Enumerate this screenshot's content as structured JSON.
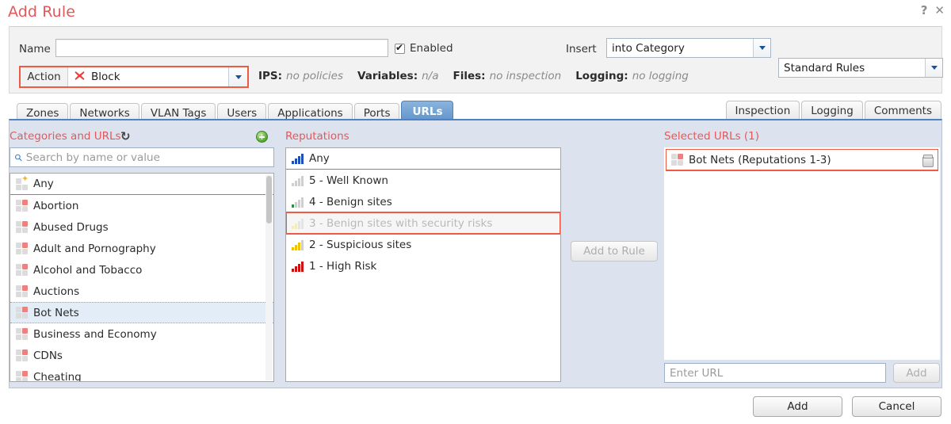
{
  "dialog": {
    "title": "Add Rule",
    "help_icon": "?",
    "close_icon": "✕"
  },
  "header": {
    "name_label": "Name",
    "name_value": "",
    "name_placeholder": "",
    "enabled_label": "Enabled",
    "enabled_checked": true,
    "insert_label": "Insert",
    "insert_value": "into Category",
    "category_value": "Standard Rules",
    "action_label": "Action",
    "action_value": "Block",
    "action_icon": "✖",
    "meta": [
      {
        "label": "IPS:",
        "value": "no policies"
      },
      {
        "label": "Variables:",
        "value": "n/a"
      },
      {
        "label": "Files:",
        "value": "no inspection"
      },
      {
        "label": "Logging:",
        "value": "no logging"
      }
    ]
  },
  "tabs_left": [
    {
      "label": "Zones",
      "active": false
    },
    {
      "label": "Networks",
      "active": false
    },
    {
      "label": "VLAN Tags",
      "active": false
    },
    {
      "label": "Users",
      "active": false
    },
    {
      "label": "Applications",
      "active": false
    },
    {
      "label": "Ports",
      "active": false
    },
    {
      "label": "URLs",
      "active": true
    }
  ],
  "tabs_right": [
    {
      "label": "Inspection",
      "active": false
    },
    {
      "label": "Logging",
      "active": false
    },
    {
      "label": "Comments",
      "active": false
    }
  ],
  "categories_panel": {
    "title": "Categories and URLs",
    "refresh_icon": "↻",
    "add_icon": "plus-circle-icon",
    "search_placeholder": "Search by name or value",
    "search_value": "",
    "items": [
      {
        "label": "Any",
        "kind": "any",
        "selected": false
      },
      {
        "label": "Abortion",
        "kind": "category",
        "selected": false
      },
      {
        "label": "Abused Drugs",
        "kind": "category",
        "selected": false
      },
      {
        "label": "Adult and Pornography",
        "kind": "category",
        "selected": false
      },
      {
        "label": "Alcohol and Tobacco",
        "kind": "category",
        "selected": false
      },
      {
        "label": "Auctions",
        "kind": "category",
        "selected": false
      },
      {
        "label": "Bot Nets",
        "kind": "category",
        "selected": true
      },
      {
        "label": "Business and Economy",
        "kind": "category",
        "selected": false
      },
      {
        "label": "CDNs",
        "kind": "category",
        "selected": false
      },
      {
        "label": "Cheating",
        "kind": "category",
        "selected": false
      }
    ]
  },
  "reputations_panel": {
    "title": "Reputations",
    "items": [
      {
        "label": "Any",
        "color": "#1f4fb5",
        "bars": 4,
        "divider": true,
        "highlight": false
      },
      {
        "label": "5 - Well Known",
        "color": "#cfcfcf",
        "bars": 0,
        "divider": false,
        "highlight": false
      },
      {
        "label": "4 - Benign sites",
        "color": "#2f8f3f",
        "bars": 1,
        "divider": false,
        "highlight": false
      },
      {
        "label": "3 - Benign sites with security risks",
        "color": "#f5e27a",
        "bars": 2,
        "divider": false,
        "highlight": true
      },
      {
        "label": "2 - Suspicious sites",
        "color": "#f2c300",
        "bars": 3,
        "divider": false,
        "highlight": false
      },
      {
        "label": "1 - High Risk",
        "color": "#cc1111",
        "bars": 4,
        "divider": false,
        "highlight": false
      }
    ],
    "add_to_rule_label": "Add to Rule"
  },
  "selected_panel": {
    "title": "Selected URLs (1)",
    "items": [
      {
        "label": "Bot Nets (Reputations 1-3)",
        "delete_icon": "trash-icon"
      }
    ],
    "url_placeholder": "Enter URL",
    "url_value": "",
    "add_url_label": "Add"
  },
  "footer": {
    "add_label": "Add",
    "cancel_label": "Cancel"
  },
  "colors": {
    "accent_red": "#e2595b",
    "highlight_orange": "#ef5b42",
    "tab_active_blue": "#5f93c9",
    "panel_bg": "#dde3ee"
  }
}
